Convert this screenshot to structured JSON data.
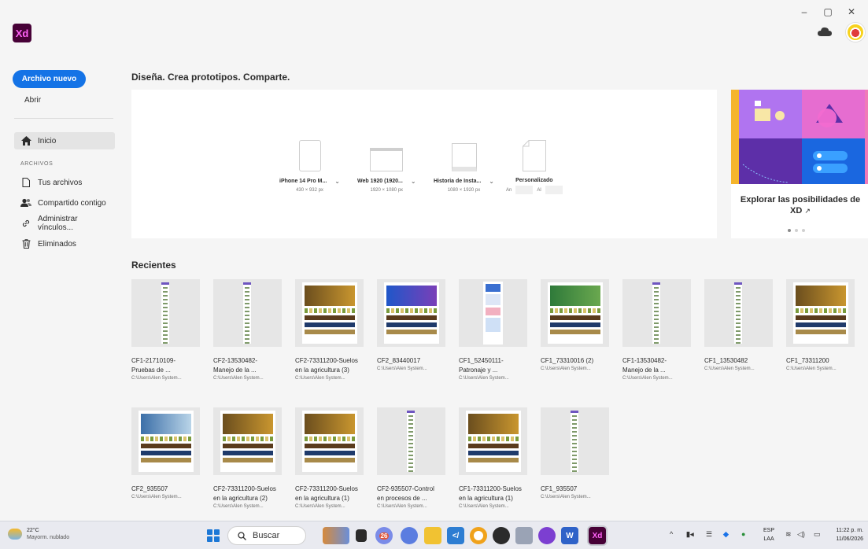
{
  "window": {
    "minimize": "–",
    "maximize": "▢",
    "close": "✕"
  },
  "app": {
    "logo_text": "Xd",
    "colors": {
      "accent": "#1473e6",
      "logo_bg": "#470137",
      "logo_fg": "#ff61f6"
    }
  },
  "sidebar": {
    "new_file": "Archivo nuevo",
    "open": "Abrir",
    "home": "Inicio",
    "section_files": "ARCHIVOS",
    "items": [
      {
        "label": "Tus archivos",
        "icon": "file-icon"
      },
      {
        "label": "Compartido contigo",
        "icon": "shared-users-icon"
      },
      {
        "label": "Administrar vínculos...",
        "icon": "link-icon"
      },
      {
        "label": "Eliminados",
        "icon": "trash-icon"
      }
    ]
  },
  "main": {
    "headline": "Diseña. Crea prototipos. Comparte.",
    "presets": [
      {
        "name": "iPhone 14 Pro M...",
        "dims": "430 × 932 px"
      },
      {
        "name": "Web 1920 (1920...",
        "dims": "1920 × 1080 px"
      },
      {
        "name": "Historia de Insta...",
        "dims": "1080 × 1920 px"
      },
      {
        "name": "Personalizado",
        "width_label": "An",
        "height_label": "Al"
      }
    ],
    "explore": {
      "text": "Explorar las posibilidades de XD",
      "external_icon": "↗"
    },
    "recent_title": "Recientes",
    "recent": [
      {
        "line1": "CF1-21710109-",
        "line2": "Pruebas de ...",
        "path": "C:\\Users\\Alen System..."
      },
      {
        "line1": "CF2-13530482-",
        "line2": "Manejo de la ...",
        "path": "C:\\Users\\Alen System..."
      },
      {
        "line1": "CF2-73311200-Suelos",
        "line2": "en la agricultura (3)",
        "path": "C:\\Users\\Alen System..."
      },
      {
        "line1": "CF2_83440017",
        "line2": "",
        "path": "C:\\Users\\Alen System..."
      },
      {
        "line1": "CF1_52450111-",
        "line2": "Patronaje y ...",
        "path": "C:\\Users\\Alen System..."
      },
      {
        "line1": "CF1_73310016 (2)",
        "line2": "",
        "path": "C:\\Users\\Alen System..."
      },
      {
        "line1": "CF1-13530482-",
        "line2": "Manejo de la ...",
        "path": "C:\\Users\\Alen System..."
      },
      {
        "line1": "CF1_13530482",
        "line2": "",
        "path": "C:\\Users\\Alen System..."
      },
      {
        "line1": "CF1_73311200",
        "line2": "",
        "path": "C:\\Users\\Alen System..."
      },
      {
        "line1": "CF2_935507",
        "line2": "",
        "path": "C:\\Users\\Alen System..."
      },
      {
        "line1": "CF2-73311200-Suelos",
        "line2": "en la agricultura (2)",
        "path": "C:\\Users\\Alen System..."
      },
      {
        "line1": "CF2-73311200-Suelos",
        "line2": "en la agricultura (1)",
        "path": "C:\\Users\\Alen System..."
      },
      {
        "line1": "CF2-935507-Control",
        "line2": "en procesos de ...",
        "path": "C:\\Users\\Alen System..."
      },
      {
        "line1": "CF1-73311200-Suelos",
        "line2": "en la agricultura (1)",
        "path": "C:\\Users\\Alen System..."
      },
      {
        "line1": "CF1_935507",
        "line2": "",
        "path": "C:\\Users\\Alen System..."
      }
    ]
  },
  "taskbar": {
    "temp": "22°C",
    "condition": "Mayorm. nublado",
    "search": "Buscar",
    "badge_1": "26",
    "lang_1": "ESP",
    "lang_2": "LAA",
    "time": "11:22 p. m.",
    "date": "11/06/2026"
  }
}
